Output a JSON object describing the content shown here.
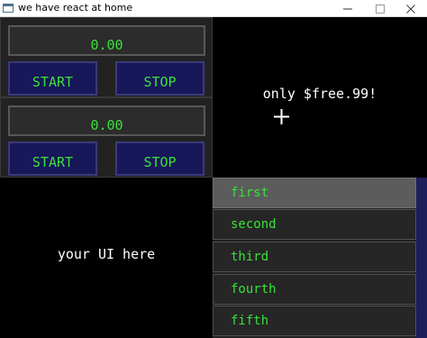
{
  "window": {
    "title": "we have react at home",
    "icon": "app-window-icon",
    "controls": [
      "minimize-icon",
      "maximize-icon",
      "close-icon"
    ]
  },
  "timers": [
    {
      "value": "0.00",
      "start_label": "START",
      "stop_label": "STOP"
    },
    {
      "value": "0.00",
      "start_label": "START",
      "stop_label": "STOP"
    }
  ],
  "promo": {
    "text": "only $free.99!",
    "cursor_icon": "crosshair-cursor-icon"
  },
  "placeholder": {
    "text": "your UI here"
  },
  "list": {
    "items": [
      "first",
      "second",
      "third",
      "fourth",
      "fifth"
    ],
    "selected_index": 0
  },
  "colors": {
    "accent_text": "#3ae03a",
    "button_bg": "#17175a",
    "panel_bg": "#222222",
    "background": "#000000",
    "selected_item_bg": "#5c5c5c"
  }
}
